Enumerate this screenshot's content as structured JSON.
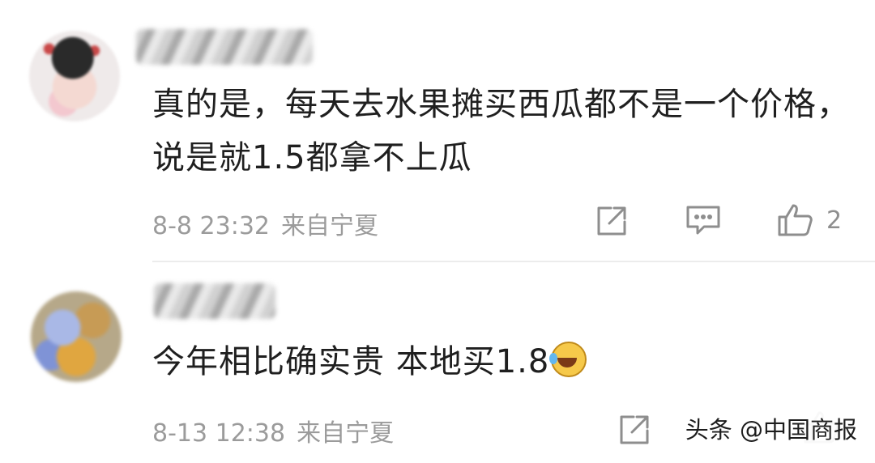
{
  "comments": [
    {
      "text": "真的是，每天去水果摊买西瓜都不是一个价格，说是就1.5都拿不上瓜",
      "time": "8-8 23:32",
      "location": "来自宁夏",
      "likes": "2"
    },
    {
      "text": "今年相比确实贵 本地买1.8",
      "time": "8-13 12:38",
      "location": "来自宁夏",
      "likes": ""
    }
  ],
  "watermark": "头条 @中国商报",
  "icons": {
    "share": "edit-share-icon",
    "reply": "comment-icon",
    "like": "thumbs-up-icon",
    "emoji": "laughing-crying-emoji"
  }
}
